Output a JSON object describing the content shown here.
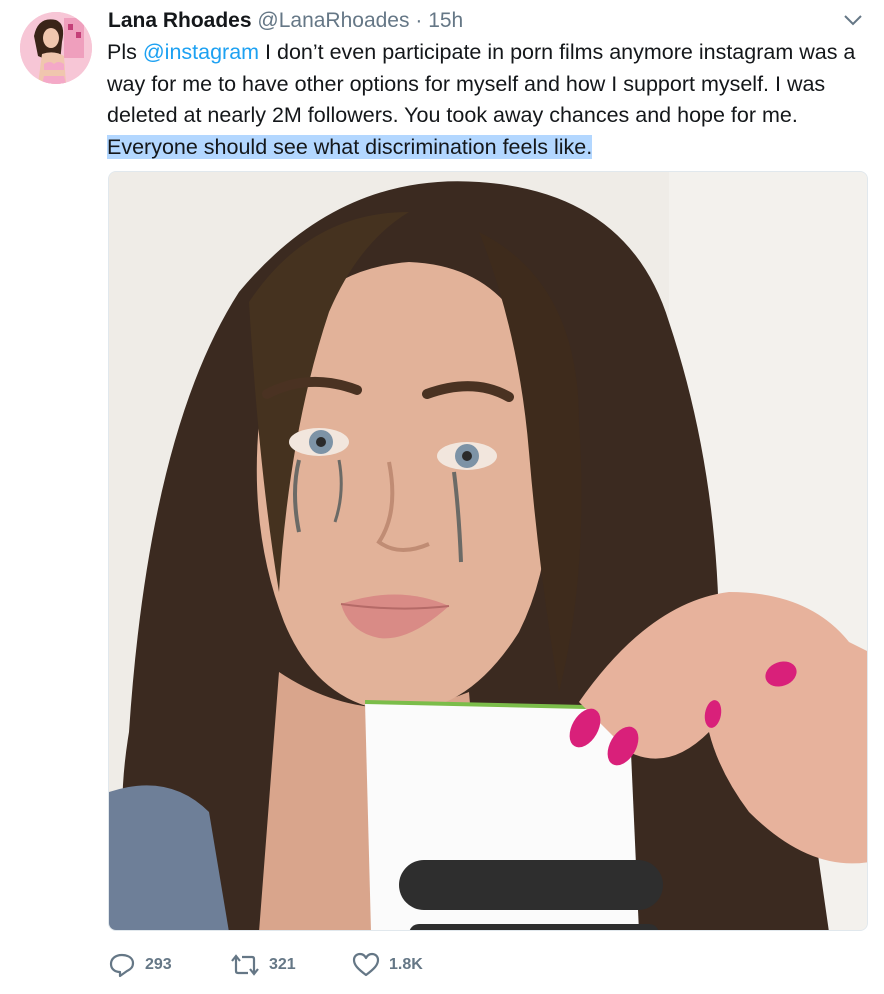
{
  "tweet": {
    "display_name": "Lana Rhoades",
    "handle": "@LanaRhoades",
    "separator": "·",
    "time": "15h",
    "text_prefix": "Pls ",
    "mention": "@instagram",
    "text_middle": " I don’t even participate in porn films anymore instagram was a way for me to have other options for myself and how I support myself. I was deleted at nearly 2M followers. You took away chances and hope for me. ",
    "text_highlighted": "Everyone should see what discrimination feels like.",
    "actions": {
      "replies": "293",
      "retweets": "321",
      "likes": "1.8K"
    }
  },
  "colors": {
    "link": "#1da1f2",
    "secondary": "#657786",
    "highlight": "#b3d7ff",
    "nail_polish": "#d9207a"
  },
  "icons": {
    "caret": "chevron-down-icon",
    "reply": "reply-icon",
    "retweet": "retweet-icon",
    "like": "heart-icon"
  }
}
